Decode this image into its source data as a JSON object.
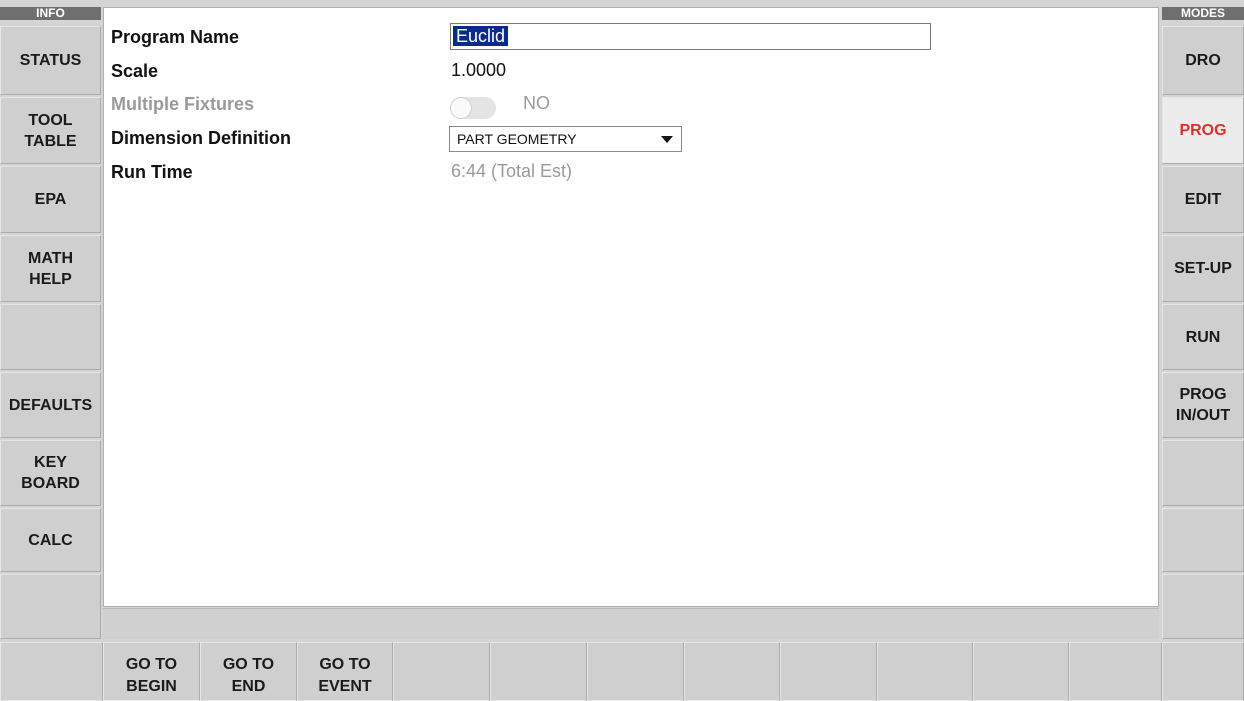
{
  "left_panel": {
    "header": "INFO",
    "buttons": [
      "STATUS",
      "TOOL\nTABLE",
      "EPA",
      "MATH\nHELP",
      "",
      "DEFAULTS",
      "KEY\nBOARD",
      "CALC",
      ""
    ]
  },
  "right_panel": {
    "header": "MODES",
    "buttons": [
      "DRO",
      "PROG",
      "EDIT",
      "SET-UP",
      "RUN",
      "PROG\nIN/OUT",
      "",
      "",
      ""
    ],
    "active": "PROG"
  },
  "form": {
    "program_name": {
      "label": "Program Name",
      "value": "Euclid"
    },
    "scale": {
      "label": "Scale",
      "value": "1.0000"
    },
    "multiple_fixtures": {
      "label": "Multiple Fixtures",
      "value": "NO",
      "enabled": false,
      "on": false
    },
    "dimension_definition": {
      "label": "Dimension Definition",
      "value": "PART GEOMETRY"
    },
    "run_time": {
      "label": "Run Time",
      "value": "6:44 (Total Est)"
    }
  },
  "bottom_bar": {
    "buttons": [
      "",
      "GO TO\nBEGIN",
      "GO TO\nEND",
      "GO TO\nEVENT",
      "",
      "",
      "",
      "",
      "",
      "",
      "",
      "",
      ""
    ]
  },
  "colors": {
    "active_mode_text": "#d9312b",
    "selection_bg": "#0a2a8c"
  }
}
